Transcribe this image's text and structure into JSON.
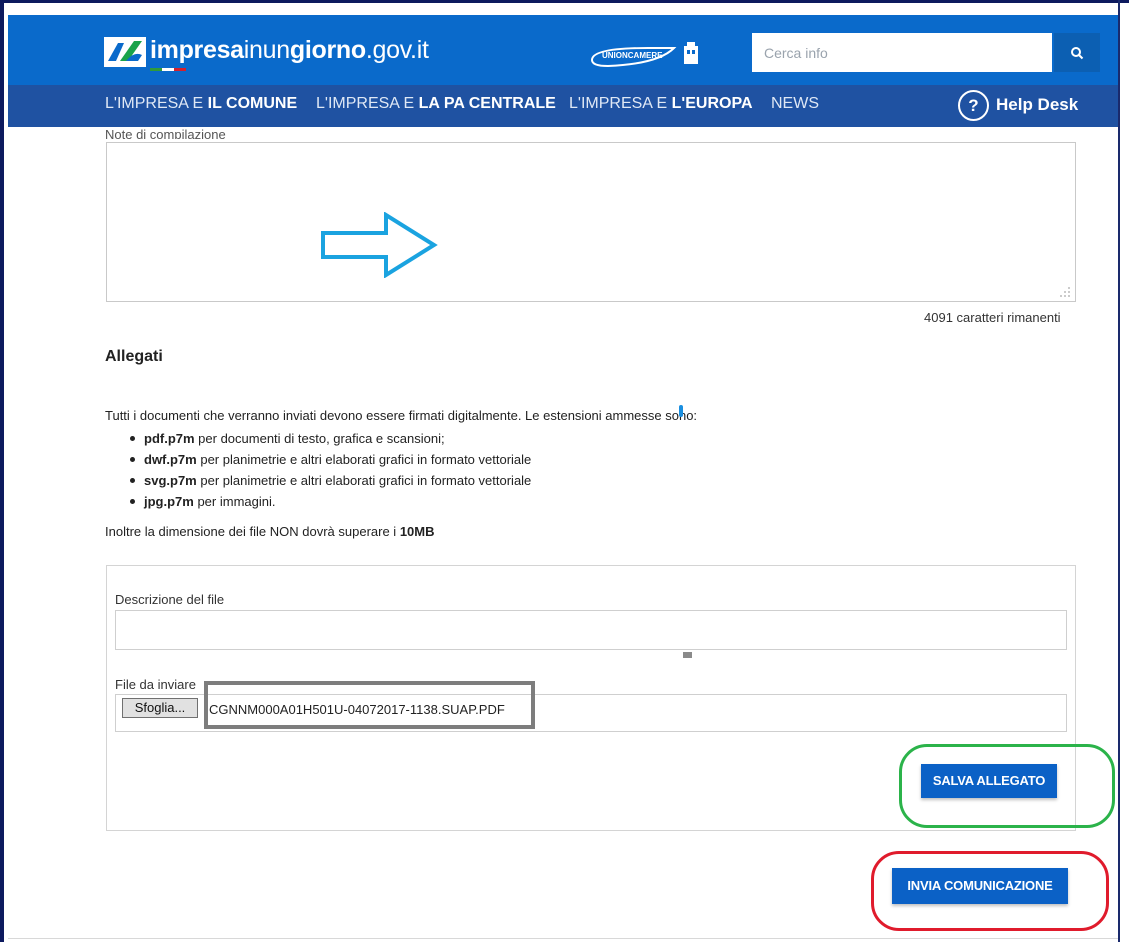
{
  "header": {
    "logo_text_bold": "impresa",
    "logo_text_regular_1": "inun",
    "logo_text_bold_2": "giorno",
    "logo_text_regular_2": ".gov.it",
    "partner_logo_text": "UNIONCAMERE",
    "search": {
      "placeholder": "Cerca info",
      "icon": "search-icon"
    },
    "nav": [
      {
        "prefix": "L'IMPRESA E ",
        "strong": "IL COMUNE"
      },
      {
        "prefix": "L'IMPRESA E ",
        "strong": "LA PA CENTRALE"
      },
      {
        "prefix": "L'IMPRESA E ",
        "strong": "L'EUROPA"
      },
      {
        "prefix": "NEWS",
        "strong": ""
      }
    ],
    "help_desk": {
      "icon_glyph": "?",
      "label": "Help Desk"
    }
  },
  "notes": {
    "label": "Note di compilazione",
    "value": "",
    "chars_remaining": "4091 caratteri rimanenti"
  },
  "attachments": {
    "title": "Allegati",
    "intro": "Tutti i documenti che verranno inviati devono essere firmati digitalmente. Le estensioni ammesse sono:",
    "extensions": [
      {
        "ext": "pdf.p7m",
        "desc": " per documenti di testo, grafica e scansioni;"
      },
      {
        "ext": "dwf.p7m",
        "desc": " per planimetrie e altri elaborati grafici in formato vettoriale"
      },
      {
        "ext": "svg.p7m",
        "desc": " per planimetrie e altri elaborati grafici in formato vettoriale"
      },
      {
        "ext": "jpg.p7m",
        "desc": " per immagini."
      }
    ],
    "size_note_prefix": "Inoltre la dimensione dei file NON dovrà superare i ",
    "size_note_limit": "10MB",
    "form": {
      "description_label": "Descrizione del file",
      "description_value": "",
      "file_label": "File da inviare",
      "browse_label": "Sfoglia...",
      "file_name": "CGNNM000A01H501U-04072017-1138.SUAP.PDF"
    },
    "save_label": "SALVA ALLEGATO"
  },
  "send_label": "INVIA COMUNICAZIONE",
  "colors": {
    "header_blue": "#0a6acb",
    "nav_blue": "#1f52a2",
    "button_blue": "#0b61c6",
    "highlight_green": "#2bb34a",
    "highlight_red": "#e01b2c",
    "arrow_cyan": "#1aa3e0"
  }
}
